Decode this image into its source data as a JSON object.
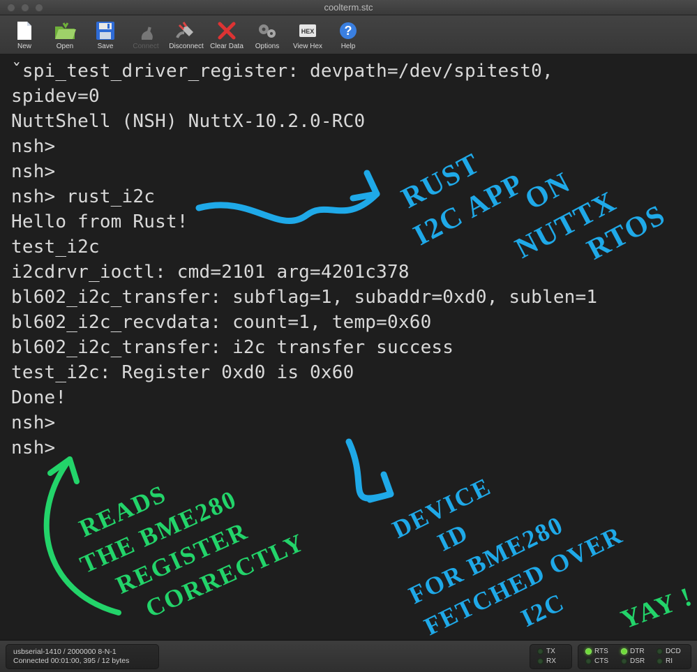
{
  "window": {
    "title": "coolterm.stc"
  },
  "toolbar": {
    "items": [
      {
        "key": "new",
        "label": "New",
        "enabled": true
      },
      {
        "key": "open",
        "label": "Open",
        "enabled": true
      },
      {
        "key": "save",
        "label": "Save",
        "enabled": true
      },
      {
        "key": "connect",
        "label": "Connect",
        "enabled": false
      },
      {
        "key": "disconnect",
        "label": "Disconnect",
        "enabled": true
      },
      {
        "key": "cleardata",
        "label": "Clear Data",
        "enabled": true
      },
      {
        "key": "options",
        "label": "Options",
        "enabled": true
      },
      {
        "key": "viewhex",
        "label": "View Hex",
        "enabled": true
      },
      {
        "key": "help",
        "label": "Help",
        "enabled": true
      }
    ]
  },
  "terminal": {
    "lines": [
      "ˇspi_test_driver_register: devpath=/dev/spitest0,",
      "spidev=0",
      "",
      "NuttShell (NSH) NuttX-10.2.0-RC0",
      "nsh>",
      "nsh>",
      "nsh> rust_i2c",
      "Hello from Rust!",
      "test_i2c",
      "i2cdrvr_ioctl: cmd=2101 arg=4201c378",
      "bl602_i2c_transfer: subflag=1, subaddr=0xd0, sublen=1",
      "bl602_i2c_recvdata: count=1, temp=0x60",
      "bl602_i2c_transfer: i2c transfer success",
      "test_i2c: Register 0xd0 is 0x60",
      "Done!",
      "nsh>",
      "nsh>"
    ]
  },
  "annotations": {
    "top_right": [
      "RUST",
      "I2C APP",
      "ON",
      "NUTTX",
      "RTOS"
    ],
    "bottom_left": [
      "READS",
      "THE BME280",
      "REGISTER",
      "CORRECTLY"
    ],
    "bottom_right": [
      "DEVICE",
      "ID",
      "FOR BME280",
      "FETCHED OVER",
      "I2C"
    ],
    "yay": "YAY !",
    "colors": {
      "blue": "#1fa9e8",
      "green": "#23d46a"
    }
  },
  "status": {
    "port_line": "usbserial-1410 / 2000000 8-N-1",
    "conn_line": "Connected 00:01:00, 395 / 12 bytes",
    "leds_txrx": [
      {
        "name": "TX",
        "on": false
      },
      {
        "name": "RX",
        "on": false
      }
    ],
    "leds_ctrl": [
      [
        {
          "name": "RTS",
          "on": true
        },
        {
          "name": "DTR",
          "on": true
        },
        {
          "name": "DCD",
          "on": false
        }
      ],
      [
        {
          "name": "CTS",
          "on": false
        },
        {
          "name": "DSR",
          "on": false
        },
        {
          "name": "RI",
          "on": false
        }
      ]
    ]
  }
}
